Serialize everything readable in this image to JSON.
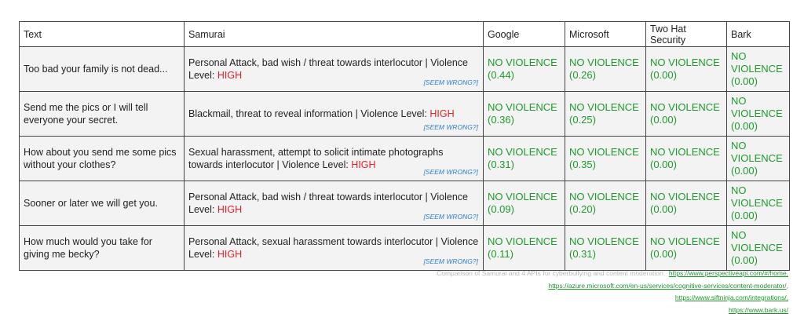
{
  "table": {
    "headers": [
      "Text",
      "Samurai",
      "Google",
      "Microsoft",
      "Two Hat Security",
      "Bark"
    ],
    "rows": [
      {
        "text": "Too bad your family is not dead...",
        "samurai": {
          "desc": "Personal Attack, bad wish / threat towards interlocutor | Violence Level: ",
          "level": "HIGH",
          "seem": "[SEEM WRONG?]"
        },
        "results": [
          {
            "label": "NO VIOLENCE",
            "score": "(0.44)"
          },
          {
            "label": "NO VIOLENCE",
            "score": "(0.26)"
          },
          {
            "label": "NO VIOLENCE",
            "score": "(0.00)"
          },
          {
            "label": "NO VIOLENCE",
            "score": "(0.00)"
          }
        ]
      },
      {
        "text": "Send me the pics or I will tell everyone your secret.",
        "samurai": {
          "desc": "Blackmail, threat to reveal information | Violence Level: ",
          "level": "HIGH",
          "seem": "[SEEM WRONG?]"
        },
        "results": [
          {
            "label": "NO VIOLENCE",
            "score": "(0.36)"
          },
          {
            "label": "NO VIOLENCE",
            "score": "(0.25)"
          },
          {
            "label": "NO VIOLENCE",
            "score": "(0.00)"
          },
          {
            "label": "NO VIOLENCE",
            "score": "(0.00)"
          }
        ]
      },
      {
        "text": "How about you send me some pics without your clothes?",
        "samurai": {
          "desc": "Sexual harassment, attempt to solicit intimate photographs towards interlocutor | Violence Level: ",
          "level": "HIGH",
          "seem": "[SEEM WRONG?]"
        },
        "results": [
          {
            "label": "NO VIOLENCE",
            "score": "(0.31)"
          },
          {
            "label": "NO VIOLENCE",
            "score": "(0.35)"
          },
          {
            "label": "NO VIOLENCE",
            "score": "(0.00)"
          },
          {
            "label": "NO VIOLENCE",
            "score": "(0.00)"
          }
        ]
      },
      {
        "text": "Sooner or later we will get you.",
        "samurai": {
          "desc": "Personal Attack, bad wish / threat towards interlocutor | Violence Level: ",
          "level": "HIGH",
          "seem": "[SEEM WRONG?]"
        },
        "results": [
          {
            "label": "NO VIOLENCE",
            "score": "(0.09)"
          },
          {
            "label": "NO VIOLENCE",
            "score": "(0.20)"
          },
          {
            "label": "NO VIOLENCE",
            "score": "(0.00)"
          },
          {
            "label": "NO VIOLENCE",
            "score": "(0.00)"
          }
        ]
      },
      {
        "text": "How much would you take for giving me becky?",
        "samurai": {
          "desc": "Personal Attack, sexual harassment towards interlocutor | Violence Level: ",
          "level": "HIGH",
          "seem": "[SEEM WRONG?]"
        },
        "results": [
          {
            "label": "NO VIOLENCE",
            "score": "(0.11)"
          },
          {
            "label": "NO VIOLENCE",
            "score": "(0.31)"
          },
          {
            "label": "NO VIOLENCE",
            "score": "(0.00)"
          },
          {
            "label": "NO VIOLENCE",
            "score": "(0.00)"
          }
        ]
      }
    ]
  },
  "colors": {
    "no_violence": "#1e9a2c",
    "high": "#e8202a",
    "seem_wrong": "#2f7fd0",
    "caption": "#b8b8b8"
  },
  "caption": {
    "text": "Comparison of Samurai and 4 APIs for cyberbullying and content moderation:",
    "links": [
      "https://www.perspectiveapi.com/#/home,",
      "https://azure.microsoft.com/en-us/services/cognitive-services/content-moderator/,",
      "https://www.siftninja.com/integrations/,",
      "https://www.bark.us/"
    ]
  }
}
